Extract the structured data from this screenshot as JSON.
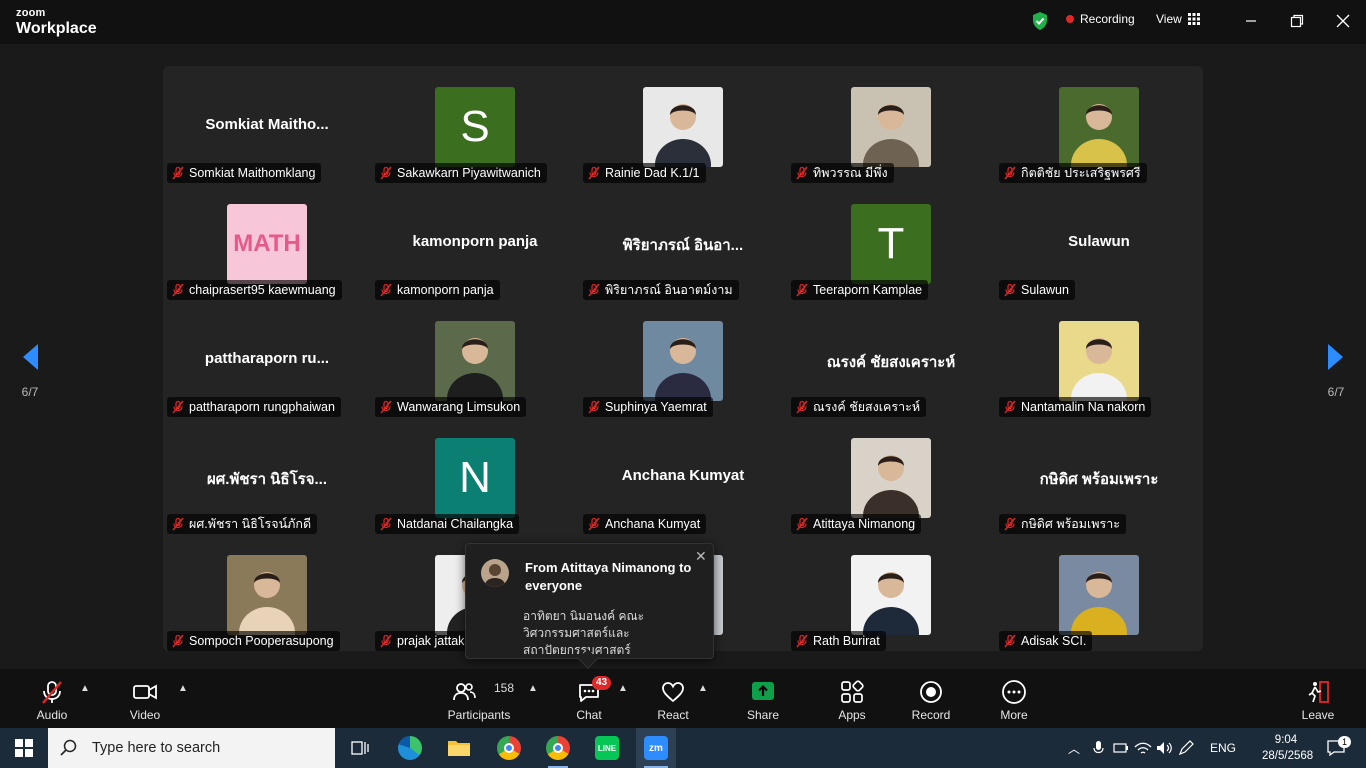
{
  "titlebar": {
    "brand_top": "zoom",
    "brand_bottom": "Workplace",
    "recording_label": "Recording",
    "view_label": "View"
  },
  "gallery": {
    "rows": [
      [
        {
          "big_name": "Somkiat  Maitho...",
          "label": "Somkiat Maithomklang",
          "type": "name"
        },
        {
          "letter": "S",
          "label": "Sakawkarn Piyawitwanich",
          "type": "letter",
          "color": "#3b6e1f"
        },
        {
          "label": "Rainie Dad K.1/1",
          "type": "photo",
          "photo_bg": "#e8e8e8",
          "photo_fg": "#2a2f3a"
        },
        {
          "label": "ทิพวรรณ มีพึ่ง",
          "type": "photo",
          "photo_bg": "#c9c2b3",
          "photo_fg": "#6e6252"
        },
        {
          "label": "กิตติชัย ประเสริฐพรศรี",
          "type": "photo",
          "photo_bg": "#4b6b2e",
          "photo_fg": "#d9c24a"
        }
      ],
      [
        {
          "label": "chaiprasert95 kaewmuang",
          "type": "photo",
          "photo_bg": "#f7c7d9",
          "photo_fg": "#e65a8a",
          "photo_text": "MATH"
        },
        {
          "big_name": "kamonporn panja",
          "label": "kamonporn panja",
          "type": "name"
        },
        {
          "big_name": "พิริยาภรณ์  อินอา...",
          "label": "พิริยาภรณ์  อินอาตม์งาม",
          "type": "name"
        },
        {
          "letter": "T",
          "label": "Teeraporn Kamplae",
          "type": "letter",
          "color": "#3b6e1f"
        },
        {
          "big_name": "Sulawun",
          "label": "Sulawun",
          "type": "name"
        }
      ],
      [
        {
          "big_name": "pattharaporn  ru...",
          "label": "pattharaporn rungphaiwan",
          "type": "name"
        },
        {
          "label": "Wanwarang Limsukon",
          "type": "photo",
          "photo_bg": "#5a6a4a",
          "photo_fg": "#1e1e1e"
        },
        {
          "label": "Suphinya Yaemrat",
          "type": "photo",
          "photo_bg": "#6f8aa0",
          "photo_fg": "#2a2a40"
        },
        {
          "big_name": "ณรงค์ ชัยสงเคราะห์",
          "label": "ณรงค์ ชัยสงเคราะห์",
          "type": "name"
        },
        {
          "label": "Nantamalin Na nakorn",
          "type": "photo",
          "photo_bg": "#e9d98a",
          "photo_fg": "#f2f2f2"
        }
      ],
      [
        {
          "big_name": "ผศ.พัชรา  นิธิโรจ...",
          "label": "ผศ.พัชรา นิธิโรจน์ภักดี",
          "type": "name"
        },
        {
          "letter": "N",
          "label": "Natdanai Chailangka",
          "type": "letter",
          "color": "#0b7f72"
        },
        {
          "big_name": "Anchana Kumyat",
          "label": "Anchana Kumyat",
          "type": "name"
        },
        {
          "label": "Atittaya Nimanong",
          "type": "photo",
          "photo_bg": "#d8d2c8",
          "photo_fg": "#3b3029"
        },
        {
          "big_name": "กษิดิศ พร้อมเพราะ",
          "label": "กษิดิศ พร้อมเพราะ",
          "type": "name"
        }
      ],
      [
        {
          "label": "Sompoch Pooperasupong",
          "type": "photo",
          "photo_bg": "#8a7a5a",
          "photo_fg": "#e8d3b8"
        },
        {
          "label": "prajak jattak",
          "type": "photo",
          "photo_bg": "#eeeeee",
          "photo_fg": "#222222"
        },
        {
          "label": "",
          "type": "photo",
          "photo_bg": "#c8ccd0",
          "photo_fg": "#888888"
        },
        {
          "label": "Rath Burirat",
          "type": "photo",
          "photo_bg": "#f2f2f2",
          "photo_fg": "#1e2a3a"
        },
        {
          "label": "Adisak SCI.",
          "type": "photo",
          "photo_bg": "#7a8aa0",
          "photo_fg": "#d9b020"
        }
      ]
    ]
  },
  "pager": {
    "left_label": "6/7",
    "right_label": "6/7"
  },
  "chat_popup": {
    "from": "From Atittaya Nimanong to everyone",
    "message": "อาทิตยา นิมอนงค์ คณะวิศวกรรมศาสตร์และสถาปัตยกรรมศาสตร์"
  },
  "toolbar": {
    "audio": "Audio",
    "video": "Video",
    "participants": "Participants",
    "participant_count": "158",
    "chat": "Chat",
    "chat_badge": "43",
    "react": "React",
    "share": "Share",
    "apps": "Apps",
    "record": "Record",
    "more": "More",
    "leave": "Leave"
  },
  "taskbar": {
    "search_placeholder": "Type here to search",
    "lang": "ENG",
    "time": "9:04",
    "date": "28/5/2568",
    "notif_count": "1"
  },
  "colors": {
    "share_green": "#0e9f4a",
    "leave_red": "#e02828",
    "mute_red": "#e02828"
  }
}
